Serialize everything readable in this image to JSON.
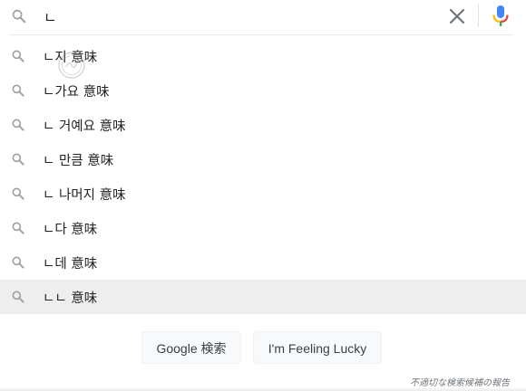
{
  "search_bar": {
    "query": "ㄴ",
    "icons": {
      "search": "search-icon",
      "clear": "close-icon",
      "voice": "microphone-icon"
    }
  },
  "suggestions": [
    {
      "text": "ㄴ지 意味",
      "selected": false
    },
    {
      "text": "ㄴ가요 意味",
      "selected": false
    },
    {
      "text": "ㄴ 거예요 意味",
      "selected": false
    },
    {
      "text": "ㄴ 만큼 意味",
      "selected": false
    },
    {
      "text": "ㄴ 나머지 意味",
      "selected": false
    },
    {
      "text": "ㄴ다 意味",
      "selected": false
    },
    {
      "text": "ㄴ데 意味",
      "selected": false
    },
    {
      "text": "ㄴㄴ 意味",
      "selected": true
    }
  ],
  "buttons": {
    "search_label": "Google 検索",
    "lucky_label": "I'm Feeling Lucky"
  },
  "report_link": "不適切な検索候補の報告",
  "colors": {
    "icon_gray": "#9aa0a6",
    "text": "#222222",
    "selected_row": "#eeeeee",
    "mic_blue": "#4285f4",
    "mic_red": "#ea4335",
    "mic_yellow": "#fbbc04",
    "mic_green": "#34a853"
  }
}
